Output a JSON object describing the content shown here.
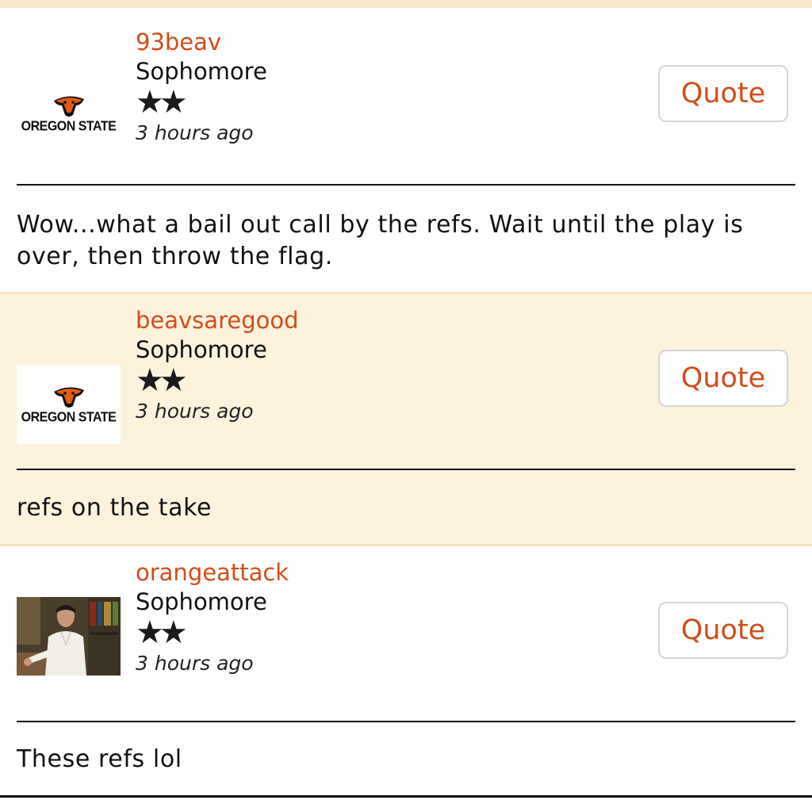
{
  "posts": [
    {
      "username": "93beav",
      "rank": "Sophomore",
      "stars": "★★",
      "timestamp": "3 hours ago",
      "quote_label": "Quote",
      "avatar_text": "OREGON STATE",
      "body": "Wow...what a bail out call by the refs. Wait until the play is over, then throw the flag."
    },
    {
      "username": "beavsaregood",
      "rank": "Sophomore",
      "stars": "★★",
      "timestamp": "3 hours ago",
      "quote_label": "Quote",
      "avatar_text": "OREGON STATE",
      "body": "refs on the take"
    },
    {
      "username": "orangeattack",
      "rank": "Sophomore",
      "stars": "★★",
      "timestamp": "3 hours ago",
      "quote_label": "Quote",
      "body": "These refs lol"
    }
  ],
  "colors": {
    "accent": "#d14d1a",
    "alt_background": "#fdf3dd",
    "separator": "#f8e2bd"
  }
}
